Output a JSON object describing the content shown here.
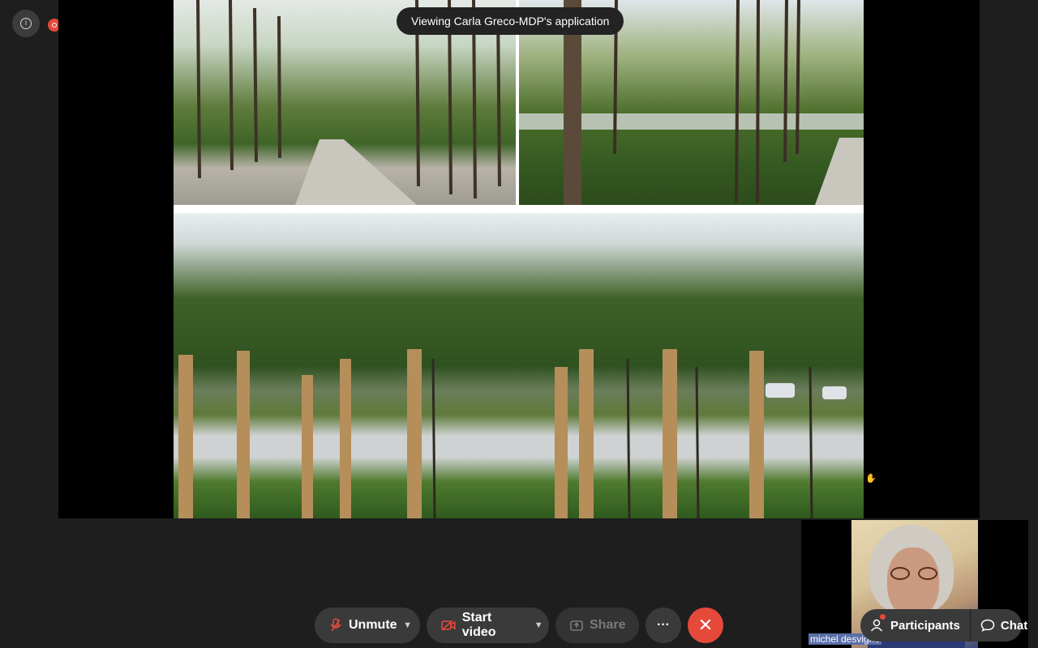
{
  "app": {
    "banner": "Viewing Carla Greco-MDP's application"
  },
  "self_view": {
    "name": "michel desvigne"
  },
  "toolbar": {
    "unmute_label": "Unmute",
    "start_video_label": "Start video",
    "share_label": "Share",
    "more_label": "···",
    "leave_label": "✕",
    "participants_label": "Participants",
    "chat_label": "Chat"
  },
  "colors": {
    "background": "#1e1e1e",
    "button": "#3a3a3a",
    "accent_red": "#e5493a"
  },
  "icons": {
    "info": "info-icon",
    "recording": "recording-icon",
    "mic_muted": "mic-muted-icon",
    "camera_off": "camera-off-icon",
    "share": "share-icon",
    "more": "more-icon",
    "leave": "close-icon",
    "participants": "participants-icon",
    "chat": "chat-icon"
  }
}
